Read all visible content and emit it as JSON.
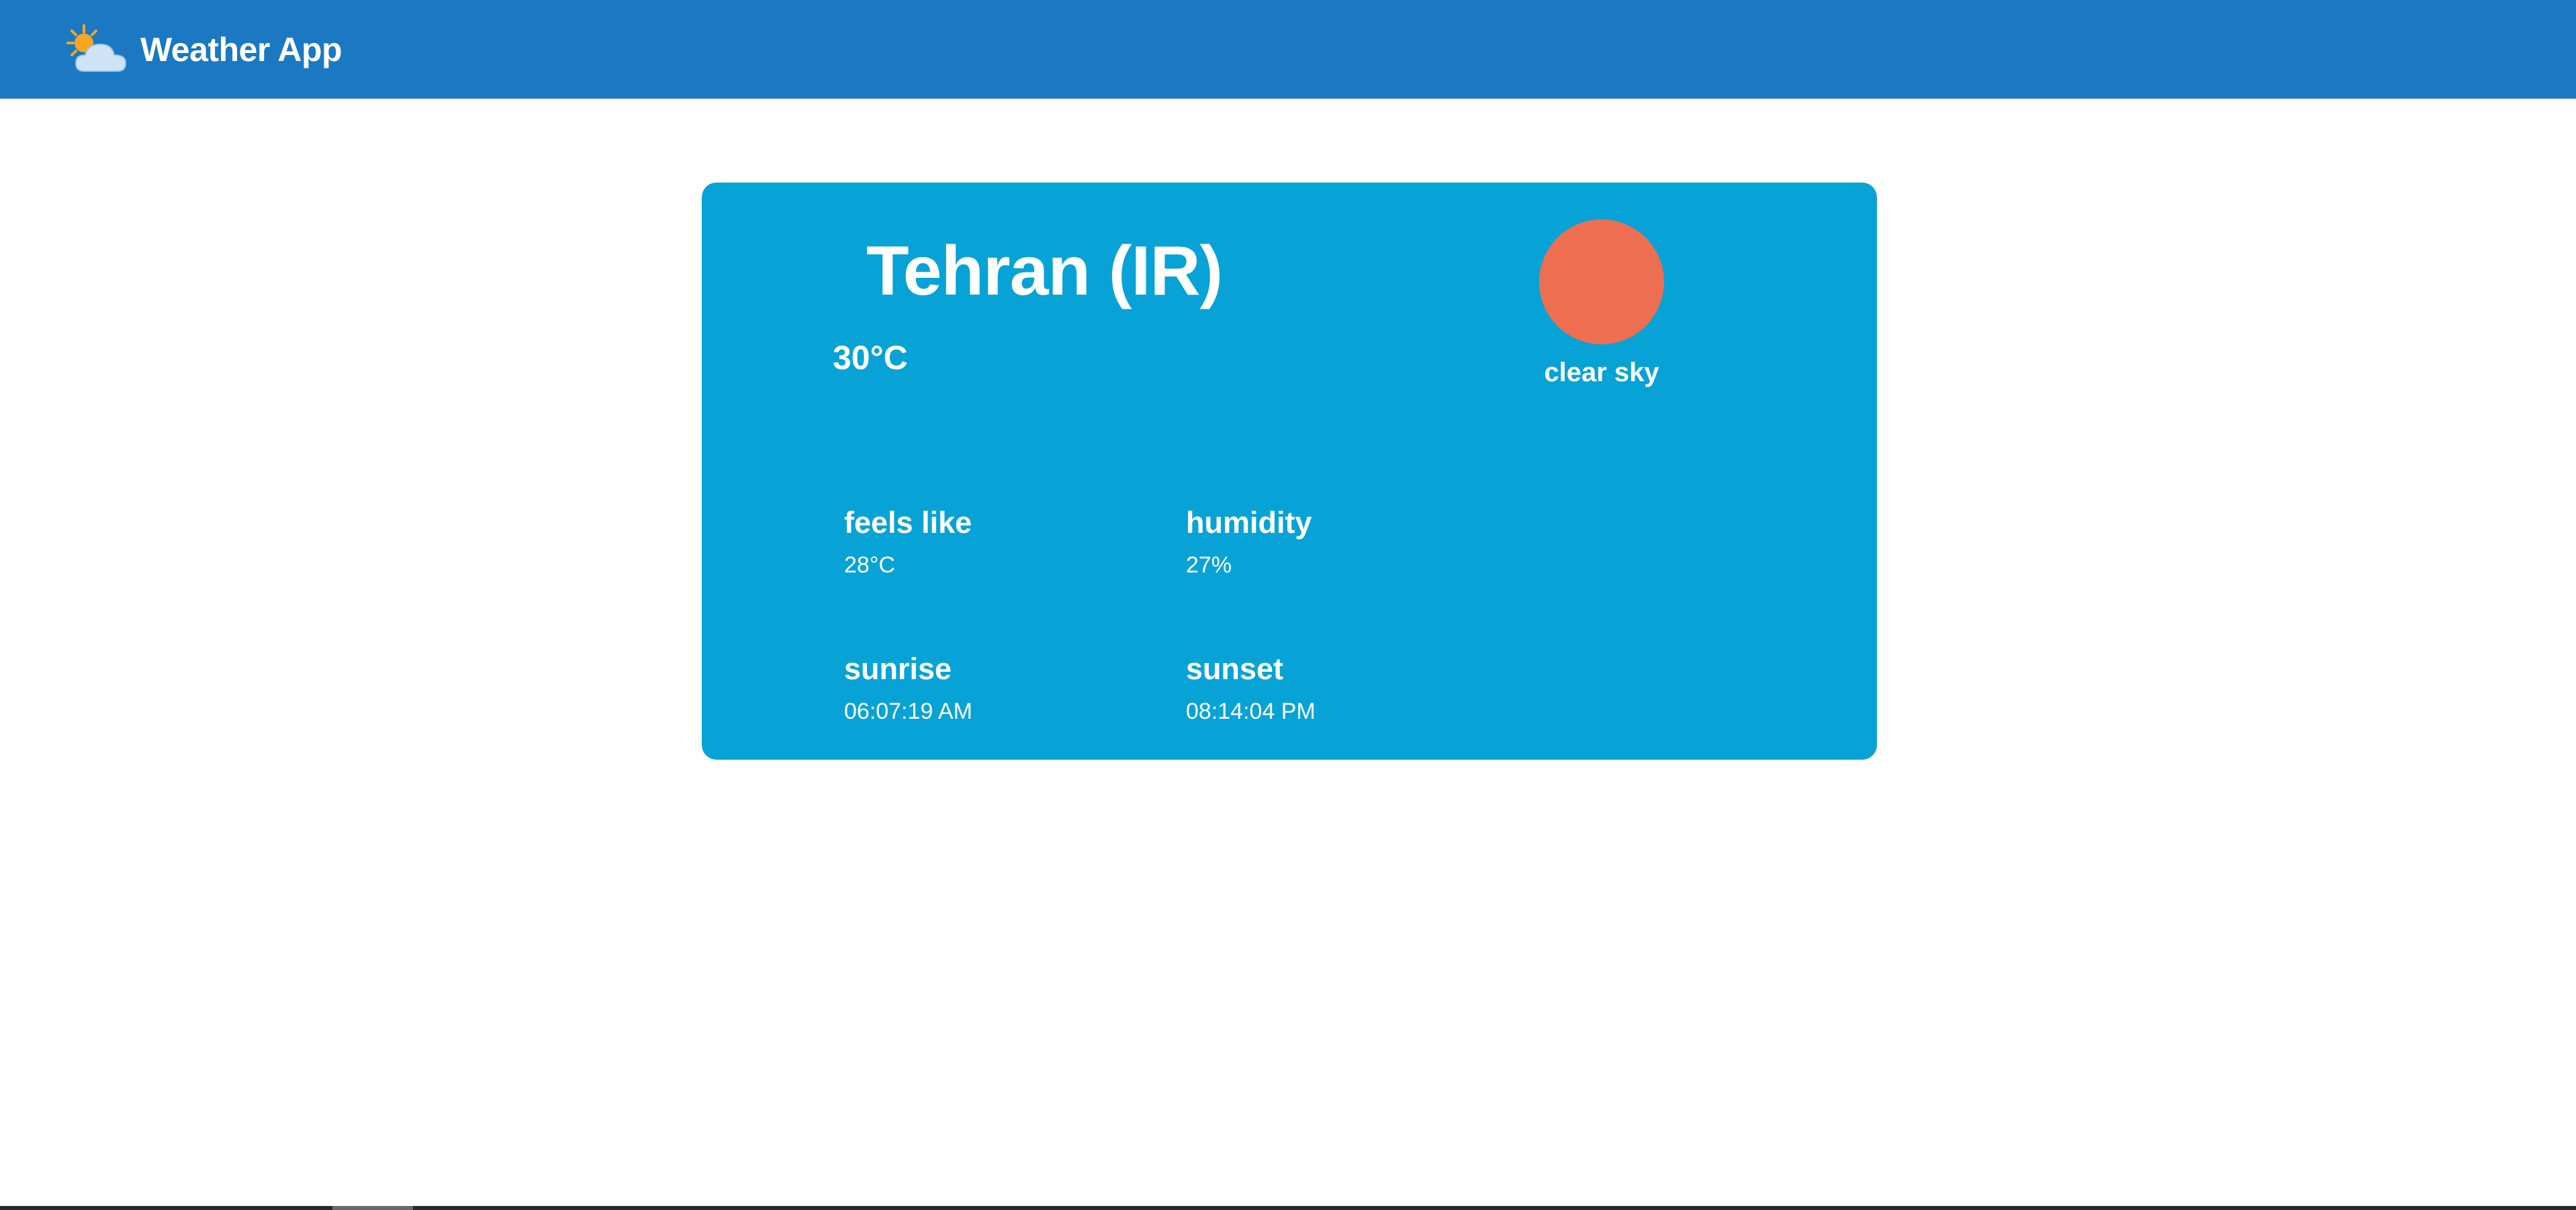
{
  "header": {
    "app_title": "Weather App",
    "logo_icon": "sun-behind-cloud-icon",
    "background": "#1b78c2"
  },
  "card": {
    "background": "#08a3d6",
    "city": "Tehran (IR)",
    "temperature": "30°C",
    "condition": {
      "icon": "sun-icon",
      "icon_color": "#ee6e52",
      "description": "clear sky"
    },
    "stats": {
      "feels_like": {
        "label": "feels like",
        "value": "28°C"
      },
      "humidity": {
        "label": "humidity",
        "value": "27%"
      },
      "sunrise": {
        "label": "sunrise",
        "value": "06:07:19 AM"
      },
      "sunset": {
        "label": "sunset",
        "value": "08:14:04 PM"
      }
    }
  }
}
